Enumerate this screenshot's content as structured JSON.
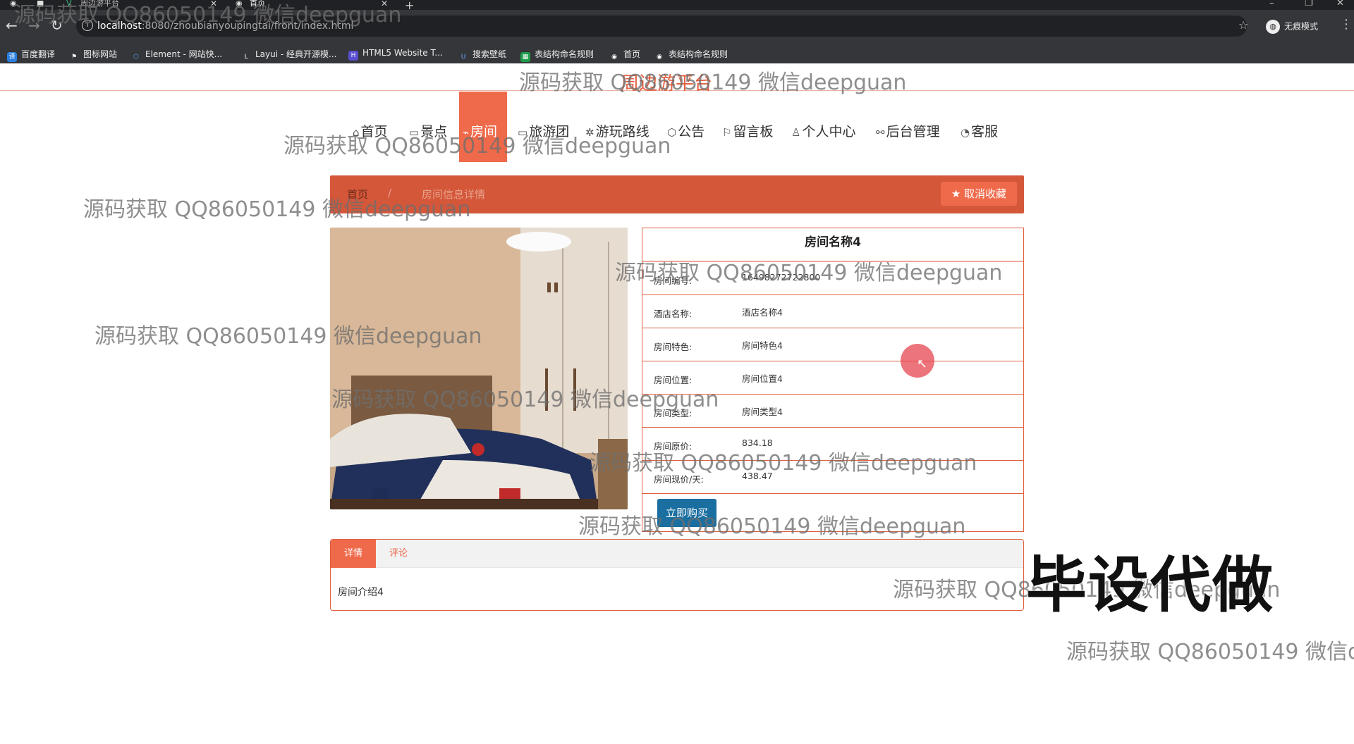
{
  "browser": {
    "tabs": [
      {
        "label": "周边游平台"
      },
      {
        "label": "首页"
      }
    ],
    "url_host": "localhost",
    "url_rest": ":8080/zhoubianyoupingtai/front/index.html",
    "incognito_label": "无痕模式",
    "bookmarks": [
      "百度翻译",
      "图标网站",
      "Element - 网站快...",
      "Layui - 经典开源模...",
      "HTML5 Website T...",
      "搜索壁纸",
      "表结构命名规则",
      "首页",
      "表结构命名规则"
    ]
  },
  "site": {
    "title": "周边游平台",
    "nav": [
      {
        "label": "首页",
        "icon": "home-icon"
      },
      {
        "label": "景点",
        "icon": "scenic-icon"
      },
      {
        "label": "房间",
        "icon": "tag-icon",
        "active": true
      },
      {
        "label": "旅游团",
        "icon": "group-icon"
      },
      {
        "label": "游玩路线",
        "icon": "route-icon"
      },
      {
        "label": "公告",
        "icon": "notice-icon"
      },
      {
        "label": "留言板",
        "icon": "flag-icon"
      },
      {
        "label": "个人中心",
        "icon": "user-icon"
      },
      {
        "label": "后台管理",
        "icon": "link-icon"
      },
      {
        "label": "客服",
        "icon": "support-icon"
      }
    ]
  },
  "breadcrumb": {
    "home": "首页",
    "separator": "/",
    "current": "房间信息详情"
  },
  "favorite_button": "取消收藏",
  "room": {
    "name": "房间名称4",
    "fields": [
      {
        "key": "房间编号:",
        "value": "16498272722800"
      },
      {
        "key": "酒店名称:",
        "value": "酒店名称4"
      },
      {
        "key": "房间特色:",
        "value": "房间特色4"
      },
      {
        "key": "房间位置:",
        "value": "房间位置4"
      },
      {
        "key": "房间类型:",
        "value": "房间类型4"
      },
      {
        "key": "房间原价:",
        "value": "834.18"
      },
      {
        "key": "房间现价/天:",
        "value": "438.47"
      }
    ],
    "buy_button": "立即购买"
  },
  "tabs": {
    "detail": "详情",
    "comment": "评论",
    "content": "房间介绍4"
  },
  "overlay": {
    "watermark": "源码获取 QQ86050149 微信deepguan",
    "promo": "毕设代做"
  },
  "colors": {
    "accent": "#ef6a4b",
    "breadcrumb_bg": "#d4573a",
    "buy_button": "#1a6ea0"
  }
}
